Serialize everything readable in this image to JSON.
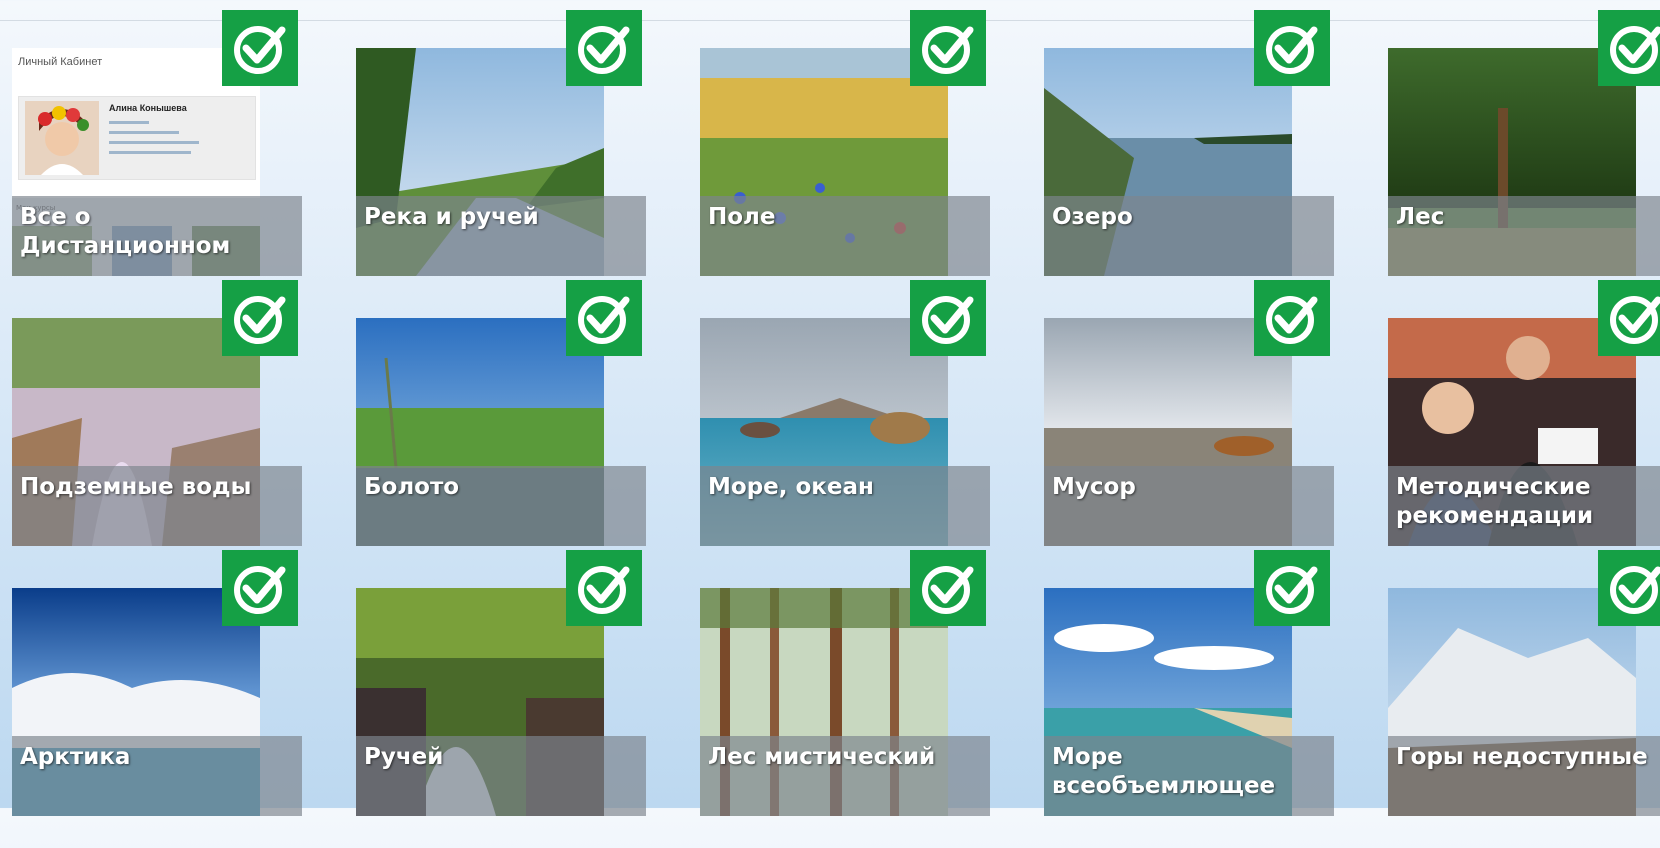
{
  "cabinet": {
    "header": "Личный Кабинет",
    "user_name": "Алина Конышева",
    "section_label": "Мои курсы",
    "tile_label": "Все о Дистанционном"
  },
  "tiles": [
    {
      "label": "Река и ручей",
      "completed": true
    },
    {
      "label": "Поле",
      "completed": true
    },
    {
      "label": "Озеро",
      "completed": true
    },
    {
      "label": "Лес",
      "completed": true
    },
    {
      "label": "Подземные воды",
      "completed": true
    },
    {
      "label": "Болото",
      "completed": true
    },
    {
      "label": "Море, океан",
      "completed": true
    },
    {
      "label": "Мусор",
      "completed": true
    },
    {
      "label": "Методические рекомендации",
      "completed": true
    },
    {
      "label": "Арктика",
      "completed": true
    },
    {
      "label": "Ручей",
      "completed": true
    },
    {
      "label": "Лес мистический",
      "completed": true
    },
    {
      "label": "Море всеобъемлющее",
      "completed": true
    },
    {
      "label": "Горы недоступные",
      "completed": true
    }
  ],
  "colors": {
    "check_green": "#15a045",
    "caption_overlay": "#7d858e"
  },
  "icons": {
    "completed": "check-circle-icon"
  }
}
